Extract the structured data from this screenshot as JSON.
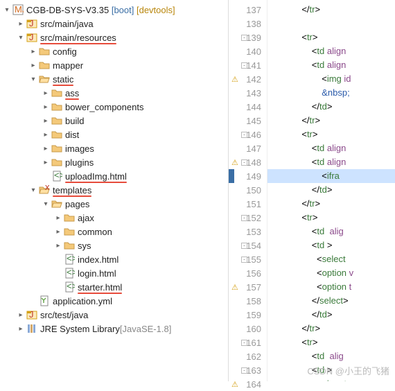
{
  "project": {
    "icon": "maven-java-icon",
    "name": "CGB-DB-SYS-V3.35",
    "boot_suffix": "[boot]",
    "dev_suffix": "[devtools]"
  },
  "tree": [
    {
      "indent": 1,
      "twisty": ">",
      "icon": "package-src-icon",
      "label": "src/main/java"
    },
    {
      "indent": 1,
      "twisty": "v",
      "icon": "package-src-icon",
      "label": "src/main/resources",
      "underline": true
    },
    {
      "indent": 2,
      "twisty": ">",
      "icon": "folder-icon",
      "label": "config"
    },
    {
      "indent": 2,
      "twisty": ">",
      "icon": "folder-icon",
      "label": "mapper"
    },
    {
      "indent": 2,
      "twisty": "v",
      "icon": "folder-open-icon",
      "label": "static",
      "underline": true
    },
    {
      "indent": 3,
      "twisty": ">",
      "icon": "folder-icon",
      "label": "ass",
      "underline": true
    },
    {
      "indent": 3,
      "twisty": ">",
      "icon": "folder-icon",
      "label": "bower_components"
    },
    {
      "indent": 3,
      "twisty": ">",
      "icon": "folder-icon",
      "label": "build"
    },
    {
      "indent": 3,
      "twisty": ">",
      "icon": "folder-icon",
      "label": "dist"
    },
    {
      "indent": 3,
      "twisty": ">",
      "icon": "folder-icon",
      "label": "images"
    },
    {
      "indent": 3,
      "twisty": ">",
      "icon": "folder-icon",
      "label": "plugins"
    },
    {
      "indent": 3,
      "twisty": "",
      "icon": "html-file-icon",
      "label": "uploadImg.html",
      "underline": true
    },
    {
      "indent": 2,
      "twisty": "v",
      "icon": "folder-open-x-icon",
      "label": "templates",
      "underline": true
    },
    {
      "indent": 3,
      "twisty": "v",
      "icon": "folder-open-icon",
      "label": "pages"
    },
    {
      "indent": 4,
      "twisty": ">",
      "icon": "folder-icon",
      "label": "ajax"
    },
    {
      "indent": 4,
      "twisty": ">",
      "icon": "folder-icon",
      "label": "common"
    },
    {
      "indent": 4,
      "twisty": ">",
      "icon": "folder-icon",
      "label": "sys"
    },
    {
      "indent": 4,
      "twisty": "",
      "icon": "html-file-icon",
      "label": "index.html"
    },
    {
      "indent": 4,
      "twisty": "",
      "icon": "html-file-icon",
      "label": "login.html"
    },
    {
      "indent": 4,
      "twisty": "",
      "icon": "html-file-icon",
      "label": "starter.html",
      "underline": true
    },
    {
      "indent": 2,
      "twisty": "",
      "icon": "yml-file-icon",
      "label": "application.yml"
    },
    {
      "indent": 1,
      "twisty": ">",
      "icon": "package-src-icon",
      "label": "src/test/java"
    },
    {
      "indent": 1,
      "twisty": ">",
      "icon": "library-icon",
      "label": "JRE System Library",
      "suffix": "[JavaSE-1.8]"
    }
  ],
  "code": {
    "lines": [
      {
        "n": 137,
        "html": "            </<t>tr</t>>"
      },
      {
        "n": 138,
        "html": ""
      },
      {
        "n": 139,
        "fold": "-",
        "html": "            <<t>tr</t>>"
      },
      {
        "n": 140,
        "html": "                <<t>td</t> <a>align</a>"
      },
      {
        "n": 141,
        "fold": "-",
        "html": "                <<t>td</t> <a>align</a>"
      },
      {
        "n": 142,
        "warn": true,
        "html": "                    <<t>img</t> <a>id</a>"
      },
      {
        "n": 143,
        "html": "                    <e>&amp;nbsp;</e>"
      },
      {
        "n": 144,
        "html": "                </<t>td</t>>"
      },
      {
        "n": 145,
        "html": "            </<t>tr</t>>"
      },
      {
        "n": 146,
        "fold": "-",
        "html": "            <<t>tr</t>>"
      },
      {
        "n": 147,
        "html": "                <<t>td</t> <a>align</a>"
      },
      {
        "n": 148,
        "fold": "-",
        "warn": true,
        "html": "                <<t>td</t> <a>align</a>"
      },
      {
        "n": 149,
        "hl": true,
        "mark": true,
        "html": "                    <<t>ifra</t>"
      },
      {
        "n": 150,
        "html": "                </<t>td</t>>"
      },
      {
        "n": 151,
        "html": "            </<t>tr</t>>"
      },
      {
        "n": 152,
        "fold": "-",
        "html": "            <<t>tr</t>>"
      },
      {
        "n": 153,
        "html": "                <<t>td</t>  <a>alig</a>"
      },
      {
        "n": 154,
        "fold": "-",
        "html": "                <<t>td</t> >"
      },
      {
        "n": 155,
        "fold": "-",
        "html": "                  <<t>select</t> "
      },
      {
        "n": 156,
        "html": "                  <<t>option</t> <a>v</a>"
      },
      {
        "n": 157,
        "warn": true,
        "html": "                  <<t>option</t> <a>t</a>"
      },
      {
        "n": 158,
        "html": "                </<t>select</t>>"
      },
      {
        "n": 159,
        "html": "                </<t>td</t>>"
      },
      {
        "n": 160,
        "html": "            </<t>tr</t>>"
      },
      {
        "n": 161,
        "fold": "-",
        "html": "            <<t>tr</t>>"
      },
      {
        "n": 162,
        "html": "                <<t>td</t>  <a>alig</a>"
      },
      {
        "n": 163,
        "fold": "-",
        "html": "                <<t>td</t> >"
      },
      {
        "n": 164,
        "warn": true,
        "html": "                    <<t>input</t>"
      }
    ]
  },
  "watermark": "CSDN @小王的飞猪"
}
